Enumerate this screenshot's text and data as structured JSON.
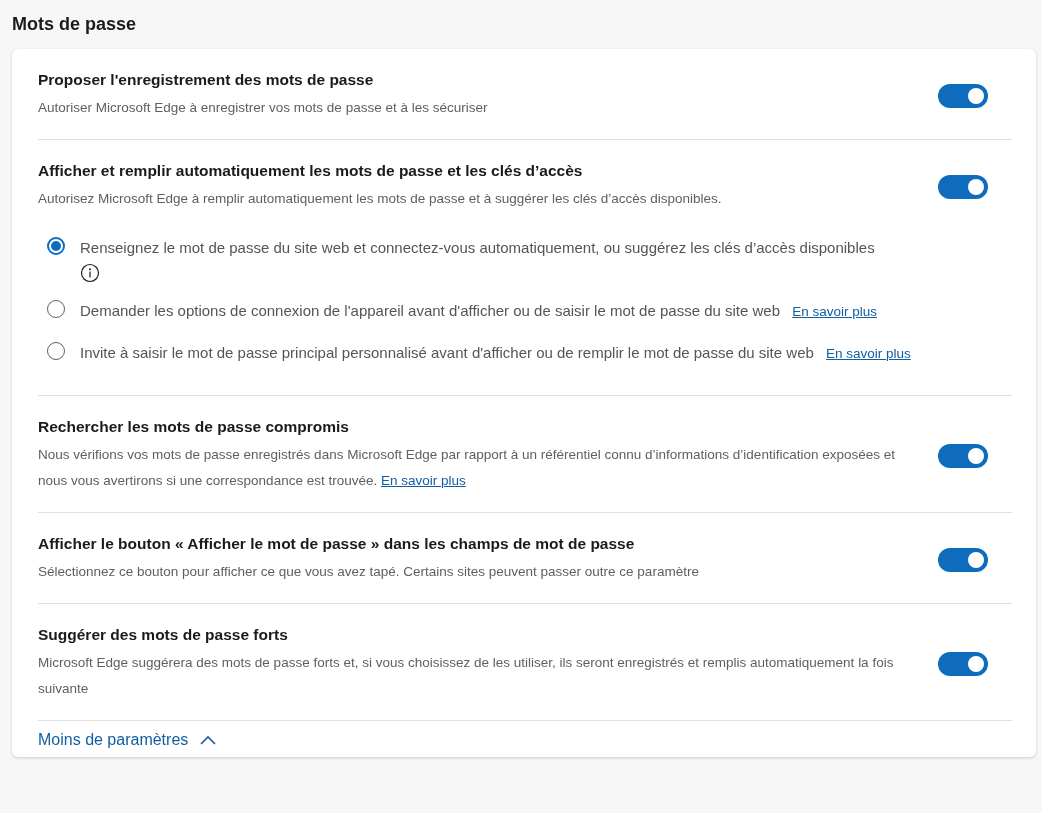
{
  "section_title": "Mots de passe",
  "settings": [
    {
      "title": "Proposer l'enregistrement des mots de passe",
      "description": "Autoriser Microsoft Edge à enregistrer vos mots de passe et à les sécuriser",
      "on": true
    },
    {
      "title": "Afficher et remplir automatiquement les mots de passe et les clés d’accès",
      "description": "Autorisez Microsoft Edge à remplir automatiquement les mots de passe et à suggérer les clés d’accès disponibles.",
      "on": true,
      "options": [
        {
          "label": "Renseignez le mot de passe du site web et connectez-vous automatiquement, ou suggérez les clés d’accès disponibles",
          "selected": true,
          "info": true
        },
        {
          "label": "Demander les options de connexion de l'appareil avant d'afficher ou de saisir le mot de passe du site web",
          "selected": false,
          "link": "En savoir plus"
        },
        {
          "label": "Invite à saisir le mot de passe principal personnalisé avant d'afficher ou de remplir le mot de passe du site web",
          "selected": false,
          "link": "En savoir plus"
        }
      ]
    },
    {
      "title": "Rechercher les mots de passe compromis",
      "description": "Nous vérifions vos mots de passe enregistrés dans Microsoft Edge par rapport à un référentiel connu d’informations d’identification exposées et nous vous avertirons si une correspondance est trouvée.",
      "link": "En savoir plus",
      "on": true
    },
    {
      "title": "Afficher le bouton « Afficher le mot de passe » dans les champs de mot de passe",
      "description": "Sélectionnez ce bouton pour afficher ce que vous avez tapé. Certains sites peuvent passer outre ce paramètre",
      "on": true
    },
    {
      "title": "Suggérer des mots de passe forts",
      "description": "Microsoft Edge suggérera des mots de passe forts et, si vous choisissez de les utiliser, ils seront enregistrés et remplis automatiquement la fois suivante",
      "on": true
    }
  ],
  "less_settings": "Moins de paramètres"
}
